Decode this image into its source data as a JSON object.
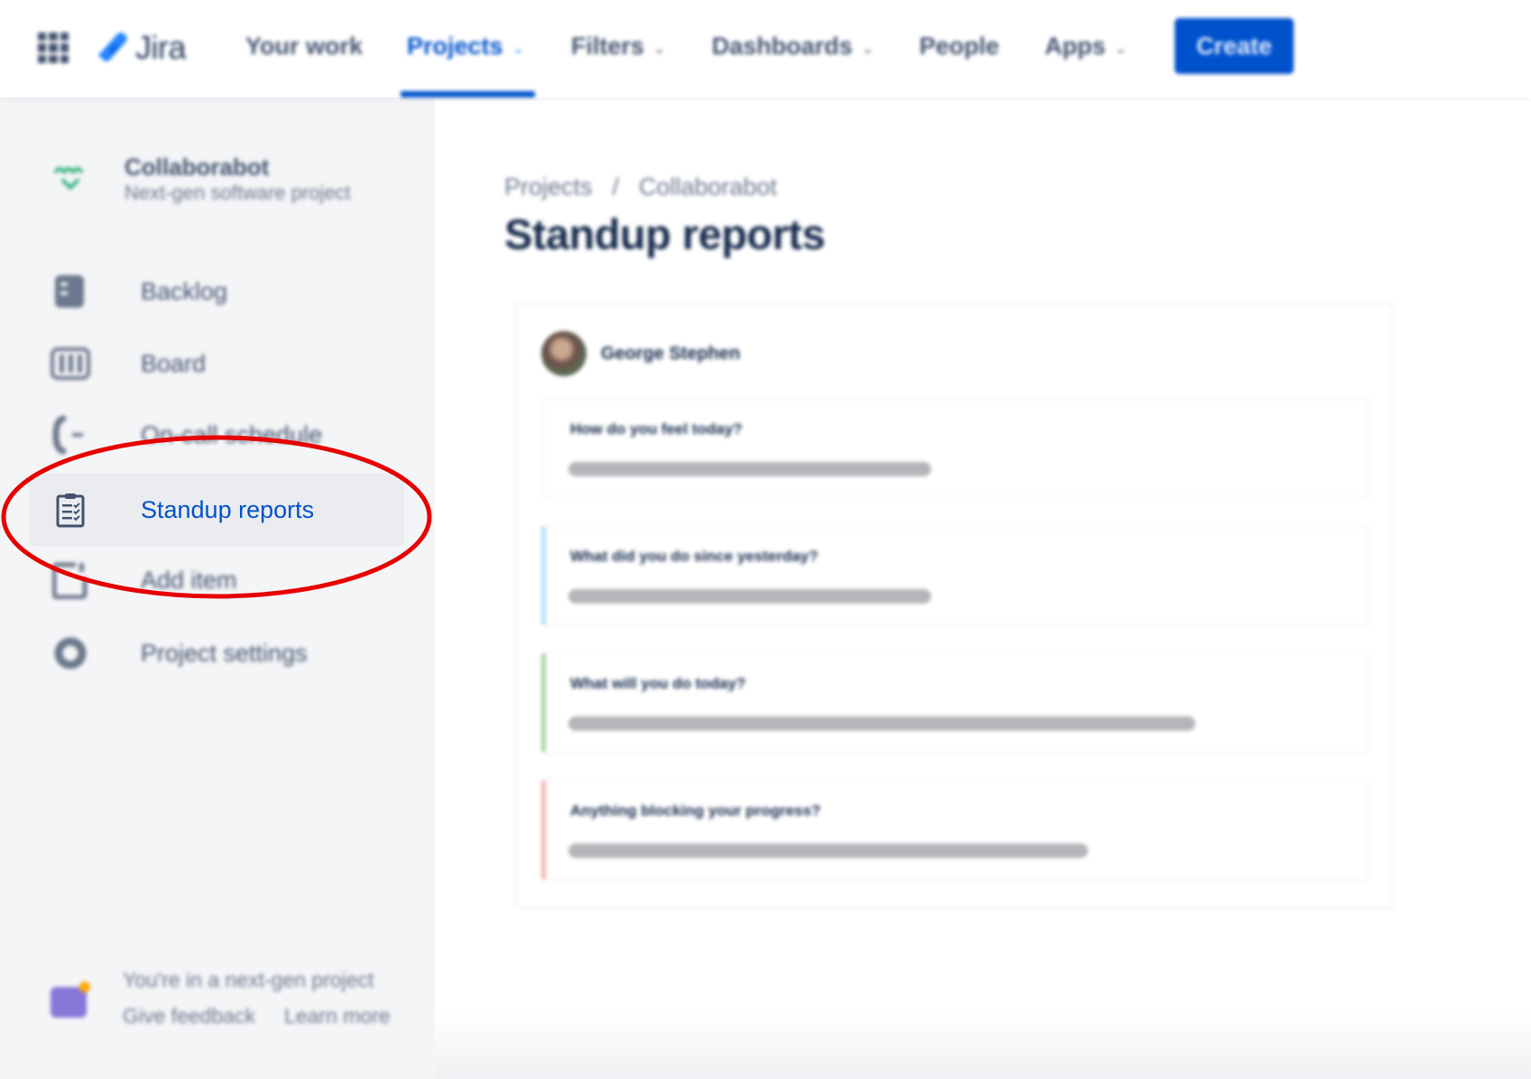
{
  "topnav": {
    "product_name": "Jira",
    "items": [
      {
        "label": "Your work",
        "has_dropdown": false,
        "active": false
      },
      {
        "label": "Projects",
        "has_dropdown": true,
        "active": true
      },
      {
        "label": "Filters",
        "has_dropdown": true,
        "active": false
      },
      {
        "label": "Dashboards",
        "has_dropdown": true,
        "active": false
      },
      {
        "label": "People",
        "has_dropdown": false,
        "active": false
      },
      {
        "label": "Apps",
        "has_dropdown": true,
        "active": false
      }
    ],
    "create_label": "Create",
    "chevron": "⌄",
    "colors": {
      "brand": "#0052cc",
      "text": "#42526e"
    }
  },
  "sidebar": {
    "project": {
      "name": "Collaborabot",
      "type": "Next-gen software project"
    },
    "items": [
      {
        "label": "Backlog",
        "icon": "backlog-icon",
        "selected": false
      },
      {
        "label": "Board",
        "icon": "board-icon",
        "selected": false
      },
      {
        "label": "On-call schedule",
        "icon": "phone-icon",
        "selected": false
      },
      {
        "label": "Standup reports",
        "icon": "clipboard-checklist-icon",
        "selected": true
      },
      {
        "label": "Add item",
        "icon": "add-item-icon",
        "selected": false
      },
      {
        "label": "Project settings",
        "icon": "gear-icon",
        "selected": false
      }
    ],
    "footer": {
      "message": "You're in a next-gen project",
      "give_feedback": "Give feedback",
      "learn_more": "Learn more"
    }
  },
  "main": {
    "breadcrumb": [
      "Projects",
      "Collaborabot"
    ],
    "breadcrumb_separator": "/",
    "title": "Standup reports",
    "report": {
      "reporter": "George Stephen",
      "questions": [
        {
          "question": "How do you feel today?",
          "accent": null,
          "answer_fill": 0.44
        },
        {
          "question": "What did you do since yesterday?",
          "accent": "#b3e0fc",
          "answer_fill": 0.44
        },
        {
          "question": "What will you do today?",
          "accent": "#abd5a4",
          "answer_fill": 0.76
        },
        {
          "question": "Anything blocking your progress?",
          "accent": "#f5b5b5",
          "answer_fill": 0.63
        }
      ]
    }
  },
  "annotation": {
    "color": "#e60000",
    "target": "Standup reports"
  }
}
